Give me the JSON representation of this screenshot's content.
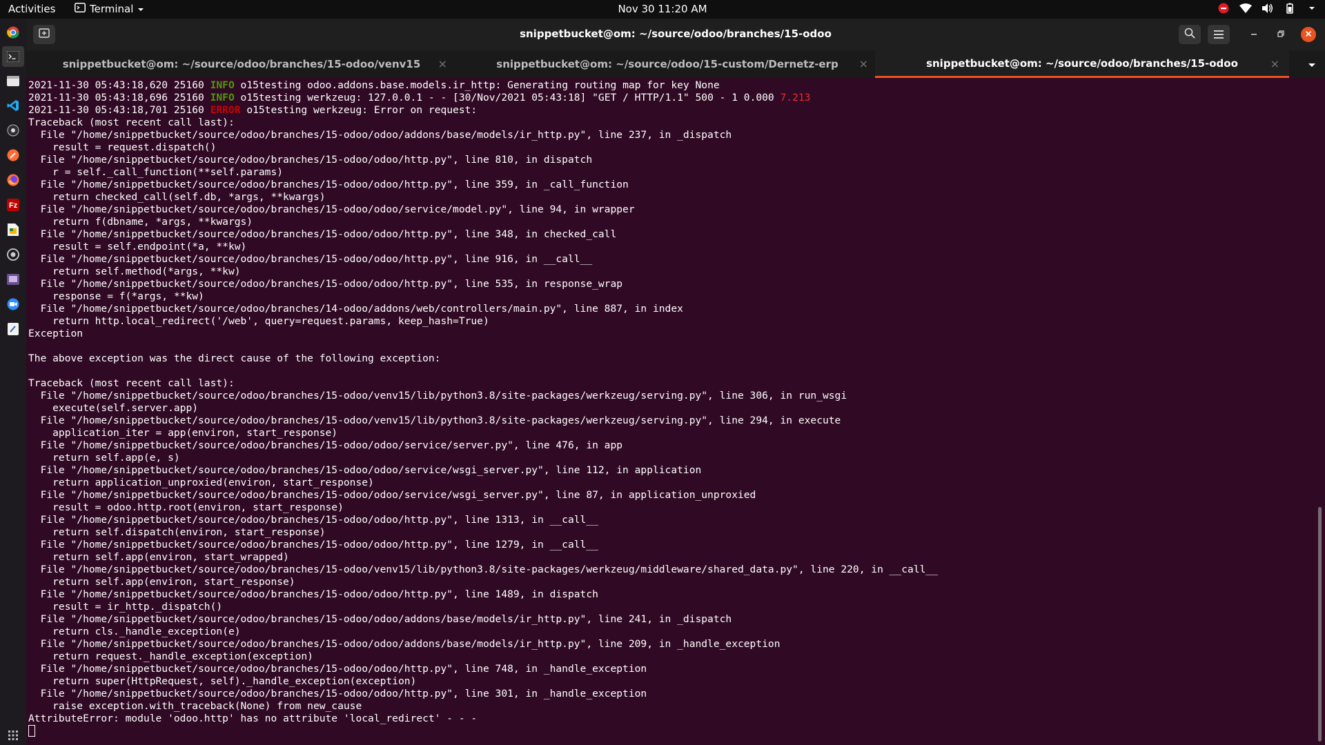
{
  "topbar": {
    "activities": "Activities",
    "app_name": "Terminal",
    "clock": "Nov 30  11:20 AM",
    "tray_icons": [
      "do-not-disturb-icon",
      "wifi-icon",
      "volume-icon",
      "battery-icon",
      "system-menu-chevron-icon"
    ]
  },
  "dock": {
    "items": [
      "chrome-icon",
      "terminal-icon",
      "files-icon",
      "vscode-icon",
      "obs-icon",
      "postman-icon",
      "firefox-icon",
      "filezilla-icon",
      "libreoffice-icon",
      "vpn-icon",
      "screenshot-icon",
      "zoom-icon",
      "text-editor-icon"
    ],
    "active_index": 1
  },
  "window": {
    "title": "snippetbucket@om: ~/source/odoo/branches/15-odoo"
  },
  "tabs": [
    {
      "label": "snippetbucket@om: ~/source/odoo/branches/15-odoo/venv15",
      "active": false
    },
    {
      "label": "snippetbucket@om: ~/source/odoo/15-custom/Dernetz-erp",
      "active": false
    },
    {
      "label": "snippetbucket@om: ~/source/odoo/branches/15-odoo",
      "active": true
    }
  ],
  "colors": {
    "terminal_bg": "#300a24",
    "info": "#4e9a06",
    "error": "#cc0000",
    "accent": "#e95420"
  },
  "terminal": {
    "lines": [
      {
        "parts": [
          {
            "t": "2021-11-30 05:43:18,620 25160 "
          },
          {
            "t": "INFO",
            "c": "info"
          },
          {
            "t": " o15testing odoo.addons.base.models.ir_http: Generating routing map for key None"
          }
        ]
      },
      {
        "parts": [
          {
            "t": "2021-11-30 05:43:18,696 25160 "
          },
          {
            "t": "INFO",
            "c": "info"
          },
          {
            "t": " o15testing werkzeug: 127.0.0.1 - - [30/Nov/2021 05:43:18] \"GET / HTTP/1.1\" 500 - 1 0.000 "
          },
          {
            "t": "7.213",
            "c": "red"
          }
        ]
      },
      {
        "parts": [
          {
            "t": "2021-11-30 05:43:18,701 25160 "
          },
          {
            "t": "ERROR",
            "c": "error"
          },
          {
            "t": " o15testing werkzeug: Error on request:"
          }
        ]
      },
      {
        "parts": [
          {
            "t": "Traceback (most recent call last):"
          }
        ]
      },
      {
        "parts": [
          {
            "t": "  File \"/home/snippetbucket/source/odoo/branches/15-odoo/odoo/addons/base/models/ir_http.py\", line 237, in _dispatch"
          }
        ]
      },
      {
        "parts": [
          {
            "t": "    result = request.dispatch()"
          }
        ]
      },
      {
        "parts": [
          {
            "t": "  File \"/home/snippetbucket/source/odoo/branches/15-odoo/odoo/http.py\", line 810, in dispatch"
          }
        ]
      },
      {
        "parts": [
          {
            "t": "    r = self._call_function(**self.params)"
          }
        ]
      },
      {
        "parts": [
          {
            "t": "  File \"/home/snippetbucket/source/odoo/branches/15-odoo/odoo/http.py\", line 359, in _call_function"
          }
        ]
      },
      {
        "parts": [
          {
            "t": "    return checked_call(self.db, *args, **kwargs)"
          }
        ]
      },
      {
        "parts": [
          {
            "t": "  File \"/home/snippetbucket/source/odoo/branches/15-odoo/odoo/service/model.py\", line 94, in wrapper"
          }
        ]
      },
      {
        "parts": [
          {
            "t": "    return f(dbname, *args, **kwargs)"
          }
        ]
      },
      {
        "parts": [
          {
            "t": "  File \"/home/snippetbucket/source/odoo/branches/15-odoo/odoo/http.py\", line 348, in checked_call"
          }
        ]
      },
      {
        "parts": [
          {
            "t": "    result = self.endpoint(*a, **kw)"
          }
        ]
      },
      {
        "parts": [
          {
            "t": "  File \"/home/snippetbucket/source/odoo/branches/15-odoo/odoo/http.py\", line 916, in __call__"
          }
        ]
      },
      {
        "parts": [
          {
            "t": "    return self.method(*args, **kw)"
          }
        ]
      },
      {
        "parts": [
          {
            "t": "  File \"/home/snippetbucket/source/odoo/branches/15-odoo/odoo/http.py\", line 535, in response_wrap"
          }
        ]
      },
      {
        "parts": [
          {
            "t": "    response = f(*args, **kw)"
          }
        ]
      },
      {
        "parts": [
          {
            "t": "  File \"/home/snippetbucket/source/odoo/branches/14-odoo/addons/web/controllers/main.py\", line 887, in index"
          }
        ]
      },
      {
        "parts": [
          {
            "t": "    return http.local_redirect('/web', query=request.params, keep_hash=True)"
          }
        ]
      },
      {
        "parts": [
          {
            "t": "Exception"
          }
        ]
      },
      {
        "parts": [
          {
            "t": ""
          }
        ]
      },
      {
        "parts": [
          {
            "t": "The above exception was the direct cause of the following exception:"
          }
        ]
      },
      {
        "parts": [
          {
            "t": ""
          }
        ]
      },
      {
        "parts": [
          {
            "t": "Traceback (most recent call last):"
          }
        ]
      },
      {
        "parts": [
          {
            "t": "  File \"/home/snippetbucket/source/odoo/branches/15-odoo/venv15/lib/python3.8/site-packages/werkzeug/serving.py\", line 306, in run_wsgi"
          }
        ]
      },
      {
        "parts": [
          {
            "t": "    execute(self.server.app)"
          }
        ]
      },
      {
        "parts": [
          {
            "t": "  File \"/home/snippetbucket/source/odoo/branches/15-odoo/venv15/lib/python3.8/site-packages/werkzeug/serving.py\", line 294, in execute"
          }
        ]
      },
      {
        "parts": [
          {
            "t": "    application_iter = app(environ, start_response)"
          }
        ]
      },
      {
        "parts": [
          {
            "t": "  File \"/home/snippetbucket/source/odoo/branches/15-odoo/odoo/service/server.py\", line 476, in app"
          }
        ]
      },
      {
        "parts": [
          {
            "t": "    return self.app(e, s)"
          }
        ]
      },
      {
        "parts": [
          {
            "t": "  File \"/home/snippetbucket/source/odoo/branches/15-odoo/odoo/service/wsgi_server.py\", line 112, in application"
          }
        ]
      },
      {
        "parts": [
          {
            "t": "    return application_unproxied(environ, start_response)"
          }
        ]
      },
      {
        "parts": [
          {
            "t": "  File \"/home/snippetbucket/source/odoo/branches/15-odoo/odoo/service/wsgi_server.py\", line 87, in application_unproxied"
          }
        ]
      },
      {
        "parts": [
          {
            "t": "    result = odoo.http.root(environ, start_response)"
          }
        ]
      },
      {
        "parts": [
          {
            "t": "  File \"/home/snippetbucket/source/odoo/branches/15-odoo/odoo/http.py\", line 1313, in __call__"
          }
        ]
      },
      {
        "parts": [
          {
            "t": "    return self.dispatch(environ, start_response)"
          }
        ]
      },
      {
        "parts": [
          {
            "t": "  File \"/home/snippetbucket/source/odoo/branches/15-odoo/odoo/http.py\", line 1279, in __call__"
          }
        ]
      },
      {
        "parts": [
          {
            "t": "    return self.app(environ, start_wrapped)"
          }
        ]
      },
      {
        "parts": [
          {
            "t": "  File \"/home/snippetbucket/source/odoo/branches/15-odoo/venv15/lib/python3.8/site-packages/werkzeug/middleware/shared_data.py\", line 220, in __call__"
          }
        ]
      },
      {
        "parts": [
          {
            "t": "    return self.app(environ, start_response)"
          }
        ]
      },
      {
        "parts": [
          {
            "t": "  File \"/home/snippetbucket/source/odoo/branches/15-odoo/odoo/http.py\", line 1489, in dispatch"
          }
        ]
      },
      {
        "parts": [
          {
            "t": "    result = ir_http._dispatch()"
          }
        ]
      },
      {
        "parts": [
          {
            "t": "  File \"/home/snippetbucket/source/odoo/branches/15-odoo/odoo/addons/base/models/ir_http.py\", line 241, in _dispatch"
          }
        ]
      },
      {
        "parts": [
          {
            "t": "    return cls._handle_exception(e)"
          }
        ]
      },
      {
        "parts": [
          {
            "t": "  File \"/home/snippetbucket/source/odoo/branches/15-odoo/odoo/addons/base/models/ir_http.py\", line 209, in _handle_exception"
          }
        ]
      },
      {
        "parts": [
          {
            "t": "    return request._handle_exception(exception)"
          }
        ]
      },
      {
        "parts": [
          {
            "t": "  File \"/home/snippetbucket/source/odoo/branches/15-odoo/odoo/http.py\", line 748, in _handle_exception"
          }
        ]
      },
      {
        "parts": [
          {
            "t": "    return super(HttpRequest, self)._handle_exception(exception)"
          }
        ]
      },
      {
        "parts": [
          {
            "t": "  File \"/home/snippetbucket/source/odoo/branches/15-odoo/odoo/http.py\", line 301, in _handle_exception"
          }
        ]
      },
      {
        "parts": [
          {
            "t": "    raise exception.with_traceback(None) from new_cause"
          }
        ]
      },
      {
        "parts": [
          {
            "t": "AttributeError: module 'odoo.http' has no attribute 'local_redirect' - - -"
          }
        ]
      }
    ]
  }
}
